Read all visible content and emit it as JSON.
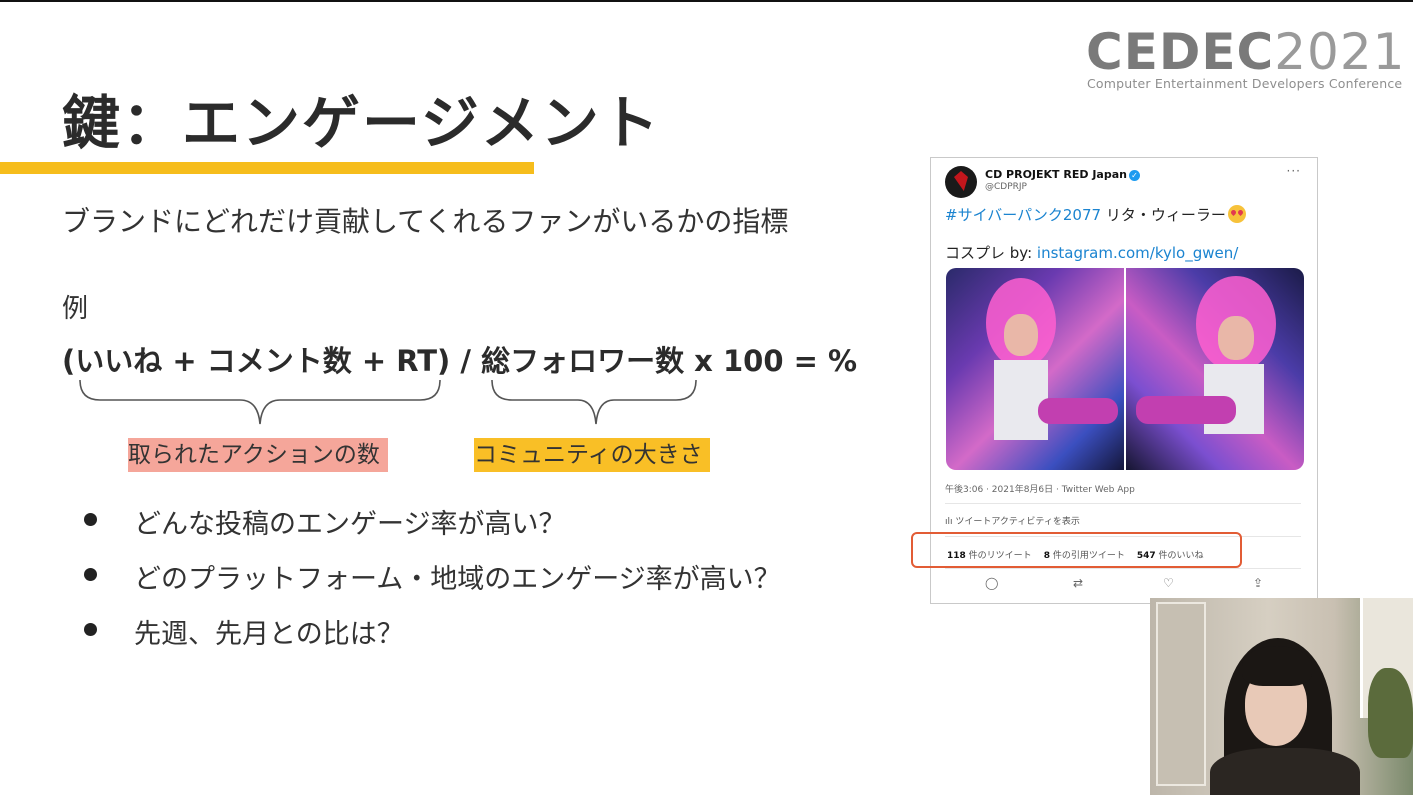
{
  "logo": {
    "cedec": "CEDEC",
    "year": "2021",
    "subtitle": "Computer Entertainment Developers Conference"
  },
  "slide": {
    "title": "鍵：エンゲージメント",
    "subtitle": "ブランドにどれだけ貢献してくれるファンがいるかの指標",
    "example_label": "例",
    "formula": "(いいね + コメント数 + RT) / 総フォロワー数 x 100 = %",
    "label_actions": "取られたアクションの数",
    "label_community": "コミュニティの大きさ",
    "bullets": [
      "どんな投稿のエンゲージ率が高い？",
      "どのプラットフォーム・地域のエンゲージ率が高い？",
      "先週、先月との比は？"
    ]
  },
  "tweet": {
    "account_name": "CD PROJEKT RED Japan",
    "handle": "@CDPRJP",
    "more": "···",
    "hashtag": "#サイバーパンク2077",
    "text_after_hashtag": " リタ・ウィーラー",
    "cosplay_prefix": "コスプレ by: ",
    "link": "instagram.com/kylo_gwen/",
    "meta": "午後3:06 · 2021年8月6日 · Twitter Web App",
    "activity": "ılı ツイートアクティビティを表示",
    "retweets_count": "118",
    "retweets_label": "件のリツイート",
    "quotes_count": "8",
    "quotes_label": "件の引用ツイート",
    "likes_count": "547",
    "likes_label": "件のいいね",
    "actions": {
      "reply": "◯",
      "retweet": "⇄",
      "like": "♡",
      "share": "⇪"
    }
  },
  "colors": {
    "title_underline": "#f6bd1c",
    "label_actions_bg": "#f5a69a",
    "label_community_bg": "#f9bf26",
    "highlight_border": "#e25c35",
    "link": "#1b84d0"
  }
}
